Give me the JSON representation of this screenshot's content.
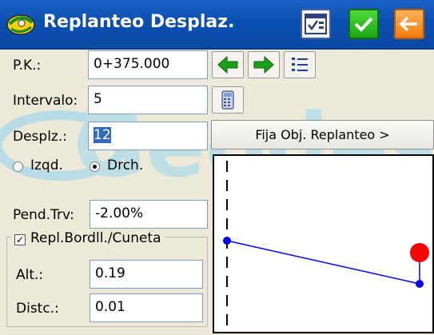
{
  "window": {
    "title": "Replanteo Desplaz.",
    "accent_color": "#0b4aa6",
    "ok_color": "#19a512",
    "back_color": "#f47b0c"
  },
  "toolbar": {
    "icons": [
      "app-logo-icon",
      "calculator-view-icon",
      "checkmark-icon",
      "arrow-left-icon"
    ]
  },
  "form": {
    "pk_label": "P.K.:",
    "pk_value": "0+375.000",
    "intervalo_label": "Intervalo:",
    "intervalo_value": "5",
    "desplz_label": "Desplz.:",
    "desplz_value": "12",
    "izqd_label": "Izqd.",
    "drch_label": "Drch.",
    "selected_side": "Drch.",
    "pend_label": "Pend.Trv:",
    "pend_value": "-2.00%",
    "fija_button_label": "Fija Obj. Replanteo >"
  },
  "group": {
    "checkbox_label": "Repl.Bordll./Cuneta",
    "checked": true,
    "alt_label": "Alt.:",
    "alt_value": "0.19",
    "distc_label": "Distc.:",
    "distc_value": "0.01"
  },
  "watermark": {
    "text": "Geodes"
  },
  "diagram": {
    "line_color": "#0000ff",
    "target_color": "#ff0000",
    "axis_color": "#000000"
  }
}
